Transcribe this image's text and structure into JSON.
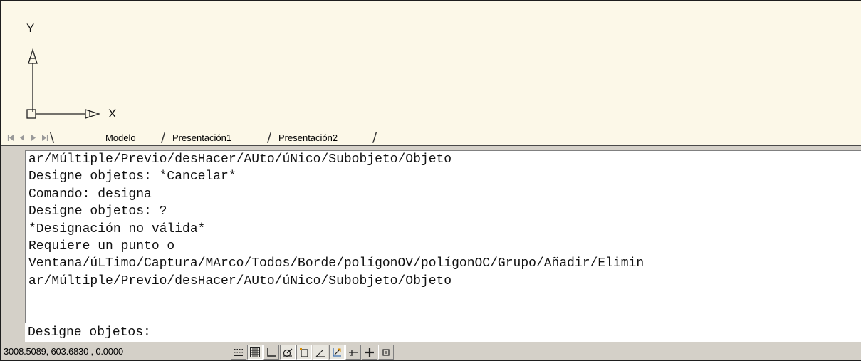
{
  "canvas": {
    "background": "#fcf8e8",
    "ucs_icon": {
      "y_label": "Y",
      "x_label": "X"
    }
  },
  "layout_tabs": {
    "nav": [
      "first-layout",
      "previous-layout",
      "next-layout",
      "last-layout"
    ],
    "tabs": [
      {
        "label": "Modelo",
        "active": true
      },
      {
        "label": "Presentación1",
        "active": false
      },
      {
        "label": "Presentación2",
        "active": false
      }
    ]
  },
  "command_window": {
    "history": [
      "ar/Múltiple/Previo/desHacer/AUto/úNico/Subobjeto/Objeto",
      "Designe objetos: *Cancelar*",
      "Comando: designa",
      "Designe objetos: ?",
      "*Designación no válida*",
      "Requiere un punto o",
      "Ventana/úLTimo/Captura/MArco/Todos/Borde/polígonOV/polígonOC/Grupo/Añadir/Elimin",
      "ar/Múltiple/Previo/desHacer/AUto/úNico/Subobjeto/Objeto"
    ],
    "prompt": "Designe objetos:"
  },
  "status_bar": {
    "coordinates": "3008.5089, 603.6830 , 0.0000",
    "toggles": [
      {
        "name": "snap",
        "icon": "snap-icon"
      },
      {
        "name": "grid",
        "icon": "grid-icon"
      },
      {
        "name": "ortho",
        "icon": "ortho-icon"
      },
      {
        "name": "polar",
        "icon": "polar-icon"
      },
      {
        "name": "osnap",
        "icon": "osnap-icon"
      },
      {
        "name": "otrack",
        "icon": "otrack-icon"
      },
      {
        "name": "ducs",
        "icon": "ducs-icon"
      },
      {
        "name": "dyn",
        "icon": "dyn-icon"
      },
      {
        "name": "lwt",
        "icon": "lineweight-icon"
      },
      {
        "name": "model",
        "icon": "model-icon"
      }
    ]
  }
}
